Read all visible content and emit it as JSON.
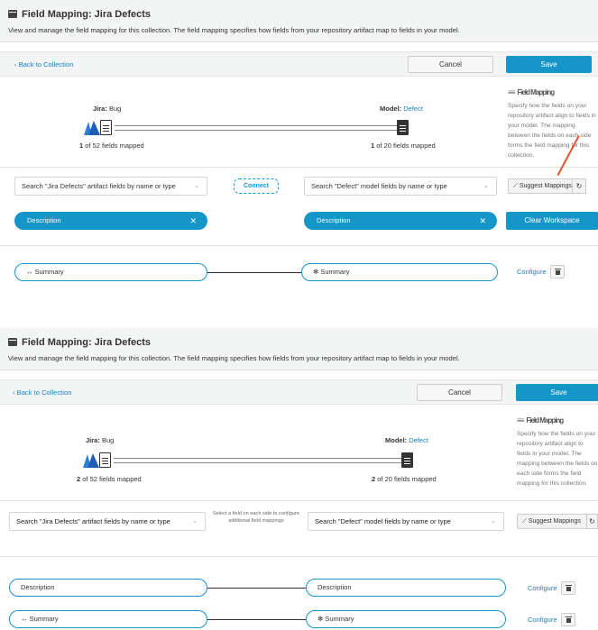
{
  "colors": {
    "accent": "#1596c8",
    "link": "#1a7fbd",
    "header_bg": "#f3f4f4",
    "arrow": "#e2562e"
  },
  "panels": [
    {
      "title": "Field Mapping: Jira Defects",
      "subtitle": "View and manage the field mapping for this collection. The field mapping specifies how fields from your repository artifact map to fields in your model.",
      "back_label": "Back to Collection",
      "cancel_label": "Cancel",
      "save_label": "Save",
      "side_title": "Field Mapping",
      "side_text": "Specify how the fields on your repository artifact align to fields in your model. The mapping between the fields on each side forms the field mapping for this collection.",
      "jira_prefix": "Jira:",
      "jira_value": "Bug",
      "model_prefix": "Model:",
      "model_value": "Defect",
      "left_count": "1",
      "left_count_text": "of 52 fields mapped",
      "right_count": "1",
      "right_count_text": "of 20 fields mapped",
      "left_search": "Search \"Jira Defects\" artifact fields by name or type",
      "right_search": "Search \"Defect\" model fields by name or type",
      "connect_label": "Connect",
      "suggest_label": "Suggest Mappings",
      "left_selected": "Description",
      "right_selected": "Description",
      "clear_label": "Clear Workspace",
      "mappings": [
        {
          "left": "↔ Summary",
          "right": "✻ Summary",
          "configure": "Configure"
        }
      ]
    },
    {
      "title": "Field Mapping: Jira Defects",
      "subtitle": "View and manage the field mapping for this collection. The field mapping specifies how fields from your repository artifact map to fields in your model.",
      "back_label": "Back to Collection",
      "cancel_label": "Cancel",
      "save_label": "Save",
      "side_title": "Field Mapping",
      "side_text": "Specify how the fields on your repository artifact align to fields in your model. The mapping between the fields on each side forms the field mapping for this collection.",
      "jira_prefix": "Jira:",
      "jira_value": "Bug",
      "model_prefix": "Model:",
      "model_value": "Defect",
      "left_count": "2",
      "left_count_text": "of 52 fields mapped",
      "right_count": "2",
      "right_count_text": "of 20 fields mapped",
      "left_search": "Search \"Jira Defects\" artifact fields by name or type",
      "right_search": "Search \"Defect\" model fields by name or type",
      "hint": "Select a field on each side to configure additional field mappings",
      "suggest_label": "Suggest Mappings",
      "mappings": [
        {
          "left": "Description",
          "right": "Description",
          "configure": "Configure"
        },
        {
          "left": "↔ Summary",
          "right": "✻ Summary",
          "configure": "Configure"
        }
      ]
    }
  ]
}
